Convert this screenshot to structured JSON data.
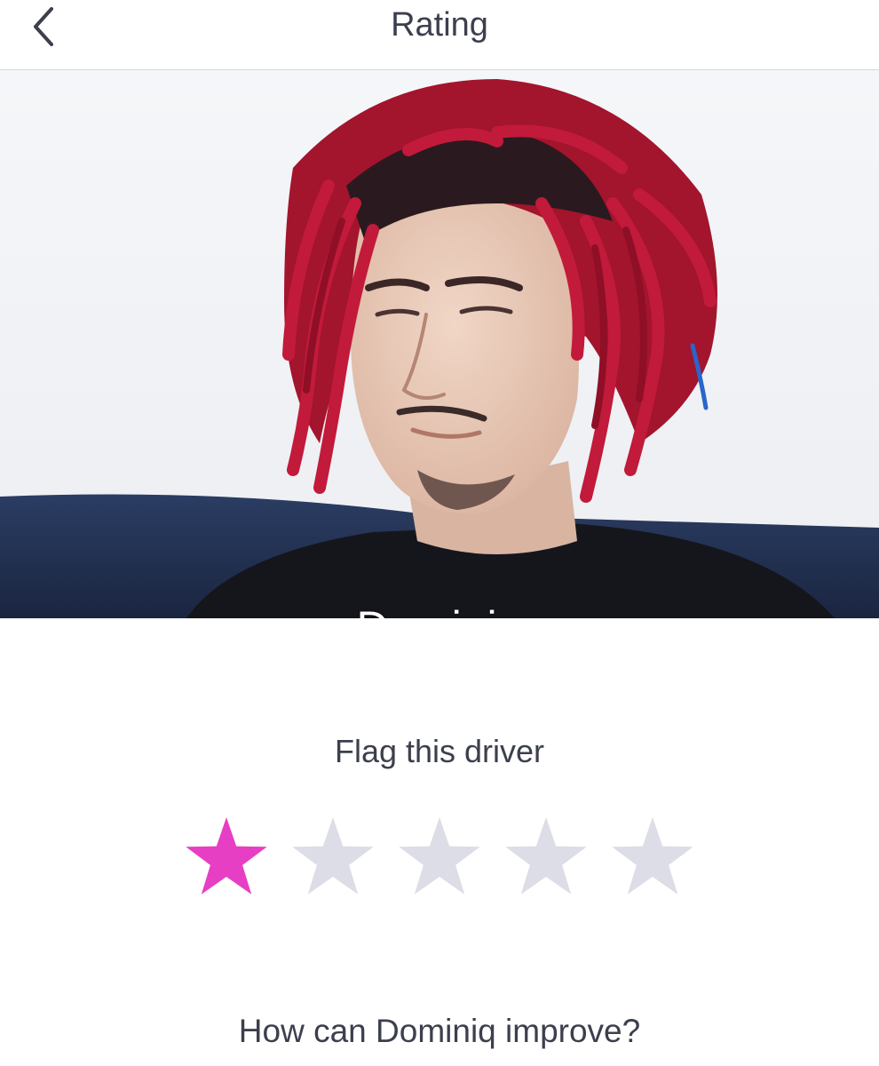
{
  "header": {
    "title": "Rating",
    "back_icon": "chevron-left-icon"
  },
  "driver": {
    "name": "Dominiq"
  },
  "rating": {
    "flag_label": "Flag this driver",
    "value": 1,
    "max": 5,
    "active_color": "#e63fc3",
    "inactive_color": "#dcdde6"
  },
  "feedback": {
    "prompt": "How can Dominiq improve?"
  }
}
